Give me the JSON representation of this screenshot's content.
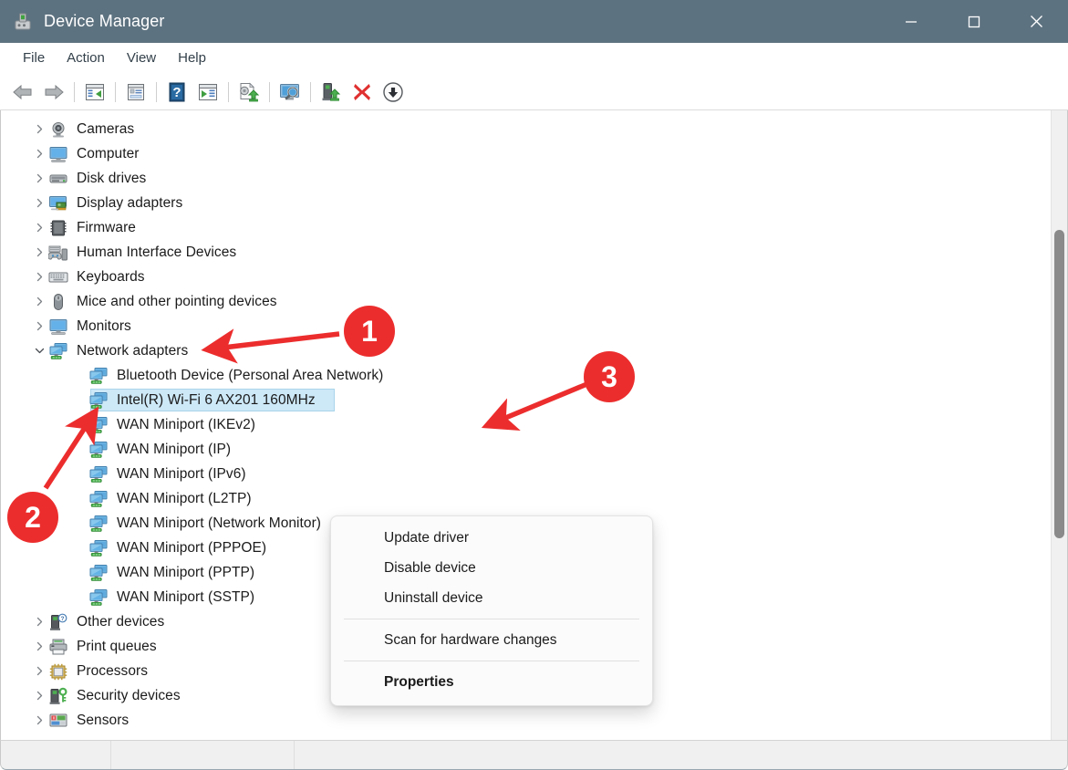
{
  "window": {
    "title": "Device Manager",
    "app_icon": "device-manager-icon",
    "controls": {
      "minimize": "minimize-icon",
      "maximize": "maximize-icon",
      "close": "close-icon"
    },
    "titlebar_color": "#5d7280"
  },
  "menubar": {
    "items": [
      {
        "label": "File"
      },
      {
        "label": "Action"
      },
      {
        "label": "View"
      },
      {
        "label": "Help"
      }
    ]
  },
  "toolbar": {
    "buttons": [
      {
        "name": "back-icon",
        "group": 0
      },
      {
        "name": "forward-icon",
        "group": 0
      },
      {
        "name": "show-hide-console-tree-icon",
        "group": 1
      },
      {
        "name": "properties-icon",
        "group": 2
      },
      {
        "name": "help-icon",
        "group": 3
      },
      {
        "name": "show-hide-action-pane-icon",
        "group": 3
      },
      {
        "name": "update-driver-icon",
        "group": 4
      },
      {
        "name": "scan-for-hardware-changes-icon",
        "group": 5
      },
      {
        "name": "uninstall-device-icon",
        "group": 6
      },
      {
        "name": "disable-device-icon",
        "group": 6
      },
      {
        "name": "enable-device-icon",
        "group": 6
      }
    ]
  },
  "tree": {
    "nodes": [
      {
        "label": "Cameras",
        "level": 0,
        "expandable": true,
        "expanded": false,
        "icon": "camera-icon",
        "selected": false
      },
      {
        "label": "Computer",
        "level": 0,
        "expandable": true,
        "expanded": false,
        "icon": "computer-icon",
        "selected": false
      },
      {
        "label": "Disk drives",
        "level": 0,
        "expandable": true,
        "expanded": false,
        "icon": "disk-drive-icon",
        "selected": false
      },
      {
        "label": "Display adapters",
        "level": 0,
        "expandable": true,
        "expanded": false,
        "icon": "display-adapter-icon",
        "selected": false
      },
      {
        "label": "Firmware",
        "level": 0,
        "expandable": true,
        "expanded": false,
        "icon": "firmware-icon",
        "selected": false
      },
      {
        "label": "Human Interface Devices",
        "level": 0,
        "expandable": true,
        "expanded": false,
        "icon": "hid-icon",
        "selected": false
      },
      {
        "label": "Keyboards",
        "level": 0,
        "expandable": true,
        "expanded": false,
        "icon": "keyboard-icon",
        "selected": false
      },
      {
        "label": "Mice and other pointing devices",
        "level": 0,
        "expandable": true,
        "expanded": false,
        "icon": "mouse-icon",
        "selected": false
      },
      {
        "label": "Monitors",
        "level": 0,
        "expandable": true,
        "expanded": false,
        "icon": "monitor-icon",
        "selected": false
      },
      {
        "label": "Network adapters",
        "level": 0,
        "expandable": true,
        "expanded": true,
        "icon": "network-adapter-icon",
        "selected": false
      },
      {
        "label": "Bluetooth Device (Personal Area Network)",
        "level": 1,
        "expandable": false,
        "expanded": false,
        "icon": "network-adapter-icon",
        "selected": false
      },
      {
        "label": "Intel(R) Wi-Fi 6 AX201 160MHz",
        "level": 1,
        "expandable": false,
        "expanded": false,
        "icon": "network-adapter-icon",
        "selected": true,
        "selection_width": 268
      },
      {
        "label": "WAN Miniport (IKEv2)",
        "level": 1,
        "expandable": false,
        "expanded": false,
        "icon": "network-adapter-icon",
        "selected": false
      },
      {
        "label": "WAN Miniport (IP)",
        "level": 1,
        "expandable": false,
        "expanded": false,
        "icon": "network-adapter-icon",
        "selected": false
      },
      {
        "label": "WAN Miniport (IPv6)",
        "level": 1,
        "expandable": false,
        "expanded": false,
        "icon": "network-adapter-icon",
        "selected": false
      },
      {
        "label": "WAN Miniport (L2TP)",
        "level": 1,
        "expandable": false,
        "expanded": false,
        "icon": "network-adapter-icon",
        "selected": false
      },
      {
        "label": "WAN Miniport (Network Monitor)",
        "level": 1,
        "expandable": false,
        "expanded": false,
        "icon": "network-adapter-icon",
        "selected": false
      },
      {
        "label": "WAN Miniport (PPPOE)",
        "level": 1,
        "expandable": false,
        "expanded": false,
        "icon": "network-adapter-icon",
        "selected": false
      },
      {
        "label": "WAN Miniport (PPTP)",
        "level": 1,
        "expandable": false,
        "expanded": false,
        "icon": "network-adapter-icon",
        "selected": false
      },
      {
        "label": "WAN Miniport (SSTP)",
        "level": 1,
        "expandable": false,
        "expanded": false,
        "icon": "network-adapter-icon",
        "selected": false
      },
      {
        "label": "Other devices",
        "level": 0,
        "expandable": true,
        "expanded": false,
        "icon": "other-device-icon",
        "selected": false
      },
      {
        "label": "Print queues",
        "level": 0,
        "expandable": true,
        "expanded": false,
        "icon": "printer-icon",
        "selected": false
      },
      {
        "label": "Processors",
        "level": 0,
        "expandable": true,
        "expanded": false,
        "icon": "processor-icon",
        "selected": false
      },
      {
        "label": "Security devices",
        "level": 0,
        "expandable": true,
        "expanded": false,
        "icon": "security-device-icon",
        "selected": false
      },
      {
        "label": "Sensors",
        "level": 0,
        "expandable": true,
        "expanded": false,
        "icon": "sensor-icon",
        "selected": false
      }
    ]
  },
  "context_menu": {
    "items": [
      {
        "label": "Update driver",
        "bold": false,
        "separator_after": false
      },
      {
        "label": "Disable device",
        "bold": false,
        "separator_after": false
      },
      {
        "label": "Uninstall device",
        "bold": false,
        "separator_after": true
      },
      {
        "label": "Scan for hardware changes",
        "bold": false,
        "separator_after": true
      },
      {
        "label": "Properties",
        "bold": true,
        "separator_after": false
      }
    ]
  },
  "annotations": {
    "badge_color": "#ec2d2d",
    "badges": [
      {
        "number": "1",
        "target": "Network adapters tree node"
      },
      {
        "number": "2",
        "target": "Intel(R) Wi-Fi 6 AX201 160MHz tree node"
      },
      {
        "number": "3",
        "target": "Update driver context menu item"
      }
    ]
  },
  "scrollbar": {
    "thumb_top_pct": 19,
    "thumb_height_pct": 49
  }
}
